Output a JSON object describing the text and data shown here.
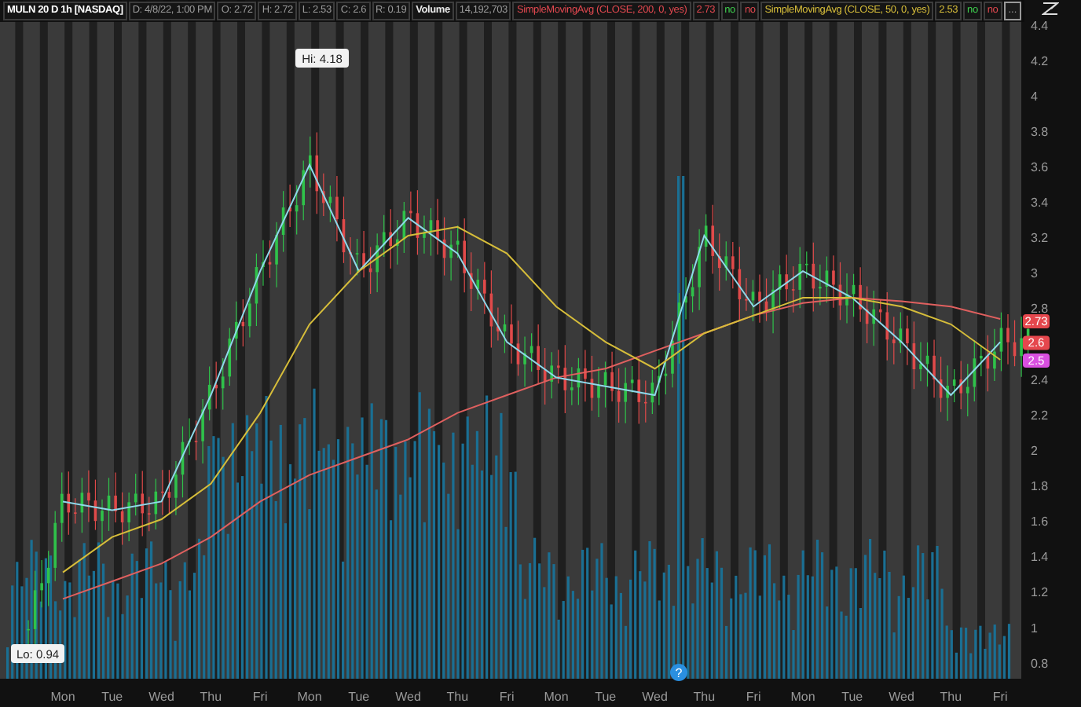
{
  "header": [
    {
      "kind": "title",
      "text": "MULN 20 D 1h [NASDAQ]",
      "color": "#ffffff"
    },
    {
      "kind": "field",
      "text": "D: 4/8/22, 1:00 PM",
      "color": "#9a9a9a"
    },
    {
      "kind": "field",
      "text": "O: 2.72",
      "color": "#9a9a9a"
    },
    {
      "kind": "field",
      "text": "H: 2.72",
      "color": "#9a9a9a"
    },
    {
      "kind": "field",
      "text": "L: 2.53",
      "color": "#9a9a9a"
    },
    {
      "kind": "field",
      "text": "C: 2.6",
      "color": "#9a9a9a"
    },
    {
      "kind": "field",
      "text": "R: 0.19",
      "color": "#9a9a9a"
    },
    {
      "kind": "title",
      "text": "Volume",
      "color": "#e8e8e8"
    },
    {
      "kind": "field",
      "text": "14,192,703",
      "color": "#9a9a9a"
    },
    {
      "kind": "study",
      "text": "SimpleMovingAvg (CLOSE, 200, 0, yes)",
      "color": "#e0484f"
    },
    {
      "kind": "field",
      "text": "2.73",
      "color": "#e0484f"
    },
    {
      "kind": "flag",
      "text": "no",
      "color": "#3fcf4f"
    },
    {
      "kind": "flag",
      "text": "no",
      "color": "#e0484f"
    },
    {
      "kind": "study",
      "text": "SimpleMovingAvg (CLOSE, 50, 0, yes)",
      "color": "#d6bd3a"
    },
    {
      "kind": "field",
      "text": "2.53",
      "color": "#d6bd3a"
    },
    {
      "kind": "flag",
      "text": "no",
      "color": "#3fcf4f"
    },
    {
      "kind": "flag",
      "text": "no",
      "color": "#e0484f"
    },
    {
      "kind": "menu",
      "text": "...",
      "color": "#9a9a9a"
    }
  ],
  "event_marker": {
    "label": "?"
  },
  "callouts": [
    {
      "kind": "high",
      "text": "Hi: 4.18"
    },
    {
      "kind": "low",
      "text": "Lo: 0.94"
    }
  ],
  "price_tags": [
    {
      "text": "2.73",
      "color": "#e5474d"
    },
    {
      "text": "2.6",
      "color": "#e5474d"
    },
    {
      "text": "2.5",
      "color": "#d94fe0"
    }
  ],
  "chart_data": {
    "type": "line",
    "categories": [
      "Mon",
      "Tue",
      "Wed",
      "Thu",
      "Fri",
      "Mon",
      "Tue",
      "Wed",
      "Thu",
      "Fri",
      "Mon",
      "Tue",
      "Wed",
      "Thu",
      "Fri",
      "Mon",
      "Tue",
      "Wed",
      "Thu",
      "Fri"
    ],
    "series": [
      {
        "color": "#e0605f",
        "values": [
          1.15,
          1.25,
          1.35,
          1.5,
          1.7,
          1.85,
          1.95,
          2.05,
          2.2,
          2.3,
          2.4,
          2.45,
          2.55,
          2.65,
          2.75,
          2.82,
          2.85,
          2.83,
          2.8,
          2.73
        ]
      },
      {
        "color": "#8fd8ea",
        "values": [
          1.7,
          1.65,
          1.7,
          2.3,
          3.0,
          3.6,
          3.0,
          3.3,
          3.1,
          2.6,
          2.4,
          2.35,
          2.3,
          3.2,
          2.8,
          3.0,
          2.85,
          2.6,
          2.3,
          2.6
        ]
      },
      {
        "color": "#d6bd3a",
        "values": [
          1.3,
          1.5,
          1.6,
          1.8,
          2.2,
          2.7,
          3.0,
          3.2,
          3.25,
          3.1,
          2.8,
          2.6,
          2.45,
          2.65,
          2.75,
          2.85,
          2.85,
          2.8,
          2.7,
          2.5
        ]
      }
    ],
    "ylim": [
      0.7,
      4.53
    ],
    "yticks": [
      0.8,
      1,
      1.2,
      1.4,
      1.6,
      1.8,
      2,
      2.2,
      2.4,
      2.8,
      3,
      3.2,
      3.4,
      3.6,
      3.8,
      4,
      4.2,
      4.4
    ]
  }
}
